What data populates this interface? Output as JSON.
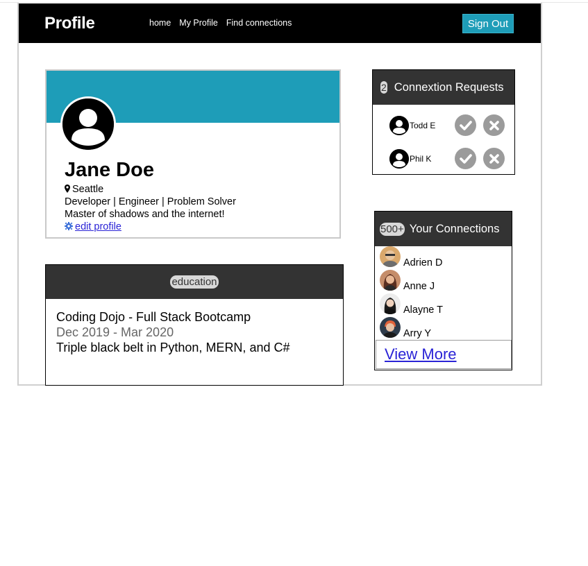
{
  "nav": {
    "brand": "Profile",
    "links": [
      "home",
      "My Profile",
      "Find connections"
    ],
    "signout_label": "Sign Out"
  },
  "profile": {
    "name": "Jane Doe",
    "location": "Seattle",
    "headline": "Developer | Engineer | Problem Solver",
    "tagline": "Master of shadows and the internet!",
    "edit_label": "edit profile"
  },
  "education": {
    "header": "education",
    "school": "Coding Dojo - Full Stack Bootcamp",
    "dates": "Dec 2019 - Mar 2020",
    "description": "Triple black belt in Python, MERN, and C#"
  },
  "requests": {
    "count": "2",
    "title": "Connextion Requests",
    "items": [
      {
        "name": "Todd E"
      },
      {
        "name": "Phil K"
      }
    ]
  },
  "connections": {
    "count": "500+",
    "title": "Your Connections",
    "items": [
      {
        "name": "Adrien D"
      },
      {
        "name": "Anne J"
      },
      {
        "name": "Alayne T"
      },
      {
        "name": "Arry Y"
      }
    ],
    "view_more": "View More"
  },
  "colors": {
    "accent": "#1e9db8",
    "header_dark": "#333333",
    "navbar": "#000000",
    "action_gray": "#9b9b9b",
    "link": "#2a23d6"
  }
}
